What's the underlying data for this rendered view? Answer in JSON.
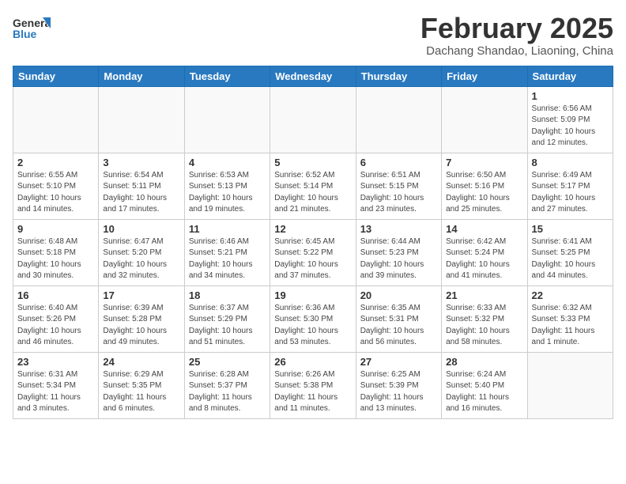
{
  "header": {
    "logo_general": "General",
    "logo_blue": "Blue",
    "month_year": "February 2025",
    "location": "Dachang Shandao, Liaoning, China"
  },
  "days_of_week": [
    "Sunday",
    "Monday",
    "Tuesday",
    "Wednesday",
    "Thursday",
    "Friday",
    "Saturday"
  ],
  "weeks": [
    [
      {
        "day": "",
        "info": ""
      },
      {
        "day": "",
        "info": ""
      },
      {
        "day": "",
        "info": ""
      },
      {
        "day": "",
        "info": ""
      },
      {
        "day": "",
        "info": ""
      },
      {
        "day": "",
        "info": ""
      },
      {
        "day": "1",
        "info": "Sunrise: 6:56 AM\nSunset: 5:09 PM\nDaylight: 10 hours\nand 12 minutes."
      }
    ],
    [
      {
        "day": "2",
        "info": "Sunrise: 6:55 AM\nSunset: 5:10 PM\nDaylight: 10 hours\nand 14 minutes."
      },
      {
        "day": "3",
        "info": "Sunrise: 6:54 AM\nSunset: 5:11 PM\nDaylight: 10 hours\nand 17 minutes."
      },
      {
        "day": "4",
        "info": "Sunrise: 6:53 AM\nSunset: 5:13 PM\nDaylight: 10 hours\nand 19 minutes."
      },
      {
        "day": "5",
        "info": "Sunrise: 6:52 AM\nSunset: 5:14 PM\nDaylight: 10 hours\nand 21 minutes."
      },
      {
        "day": "6",
        "info": "Sunrise: 6:51 AM\nSunset: 5:15 PM\nDaylight: 10 hours\nand 23 minutes."
      },
      {
        "day": "7",
        "info": "Sunrise: 6:50 AM\nSunset: 5:16 PM\nDaylight: 10 hours\nand 25 minutes."
      },
      {
        "day": "8",
        "info": "Sunrise: 6:49 AM\nSunset: 5:17 PM\nDaylight: 10 hours\nand 27 minutes."
      }
    ],
    [
      {
        "day": "9",
        "info": "Sunrise: 6:48 AM\nSunset: 5:18 PM\nDaylight: 10 hours\nand 30 minutes."
      },
      {
        "day": "10",
        "info": "Sunrise: 6:47 AM\nSunset: 5:20 PM\nDaylight: 10 hours\nand 32 minutes."
      },
      {
        "day": "11",
        "info": "Sunrise: 6:46 AM\nSunset: 5:21 PM\nDaylight: 10 hours\nand 34 minutes."
      },
      {
        "day": "12",
        "info": "Sunrise: 6:45 AM\nSunset: 5:22 PM\nDaylight: 10 hours\nand 37 minutes."
      },
      {
        "day": "13",
        "info": "Sunrise: 6:44 AM\nSunset: 5:23 PM\nDaylight: 10 hours\nand 39 minutes."
      },
      {
        "day": "14",
        "info": "Sunrise: 6:42 AM\nSunset: 5:24 PM\nDaylight: 10 hours\nand 41 minutes."
      },
      {
        "day": "15",
        "info": "Sunrise: 6:41 AM\nSunset: 5:25 PM\nDaylight: 10 hours\nand 44 minutes."
      }
    ],
    [
      {
        "day": "16",
        "info": "Sunrise: 6:40 AM\nSunset: 5:26 PM\nDaylight: 10 hours\nand 46 minutes."
      },
      {
        "day": "17",
        "info": "Sunrise: 6:39 AM\nSunset: 5:28 PM\nDaylight: 10 hours\nand 49 minutes."
      },
      {
        "day": "18",
        "info": "Sunrise: 6:37 AM\nSunset: 5:29 PM\nDaylight: 10 hours\nand 51 minutes."
      },
      {
        "day": "19",
        "info": "Sunrise: 6:36 AM\nSunset: 5:30 PM\nDaylight: 10 hours\nand 53 minutes."
      },
      {
        "day": "20",
        "info": "Sunrise: 6:35 AM\nSunset: 5:31 PM\nDaylight: 10 hours\nand 56 minutes."
      },
      {
        "day": "21",
        "info": "Sunrise: 6:33 AM\nSunset: 5:32 PM\nDaylight: 10 hours\nand 58 minutes."
      },
      {
        "day": "22",
        "info": "Sunrise: 6:32 AM\nSunset: 5:33 PM\nDaylight: 11 hours\nand 1 minute."
      }
    ],
    [
      {
        "day": "23",
        "info": "Sunrise: 6:31 AM\nSunset: 5:34 PM\nDaylight: 11 hours\nand 3 minutes."
      },
      {
        "day": "24",
        "info": "Sunrise: 6:29 AM\nSunset: 5:35 PM\nDaylight: 11 hours\nand 6 minutes."
      },
      {
        "day": "25",
        "info": "Sunrise: 6:28 AM\nSunset: 5:37 PM\nDaylight: 11 hours\nand 8 minutes."
      },
      {
        "day": "26",
        "info": "Sunrise: 6:26 AM\nSunset: 5:38 PM\nDaylight: 11 hours\nand 11 minutes."
      },
      {
        "day": "27",
        "info": "Sunrise: 6:25 AM\nSunset: 5:39 PM\nDaylight: 11 hours\nand 13 minutes."
      },
      {
        "day": "28",
        "info": "Sunrise: 6:24 AM\nSunset: 5:40 PM\nDaylight: 11 hours\nand 16 minutes."
      },
      {
        "day": "",
        "info": ""
      }
    ]
  ]
}
